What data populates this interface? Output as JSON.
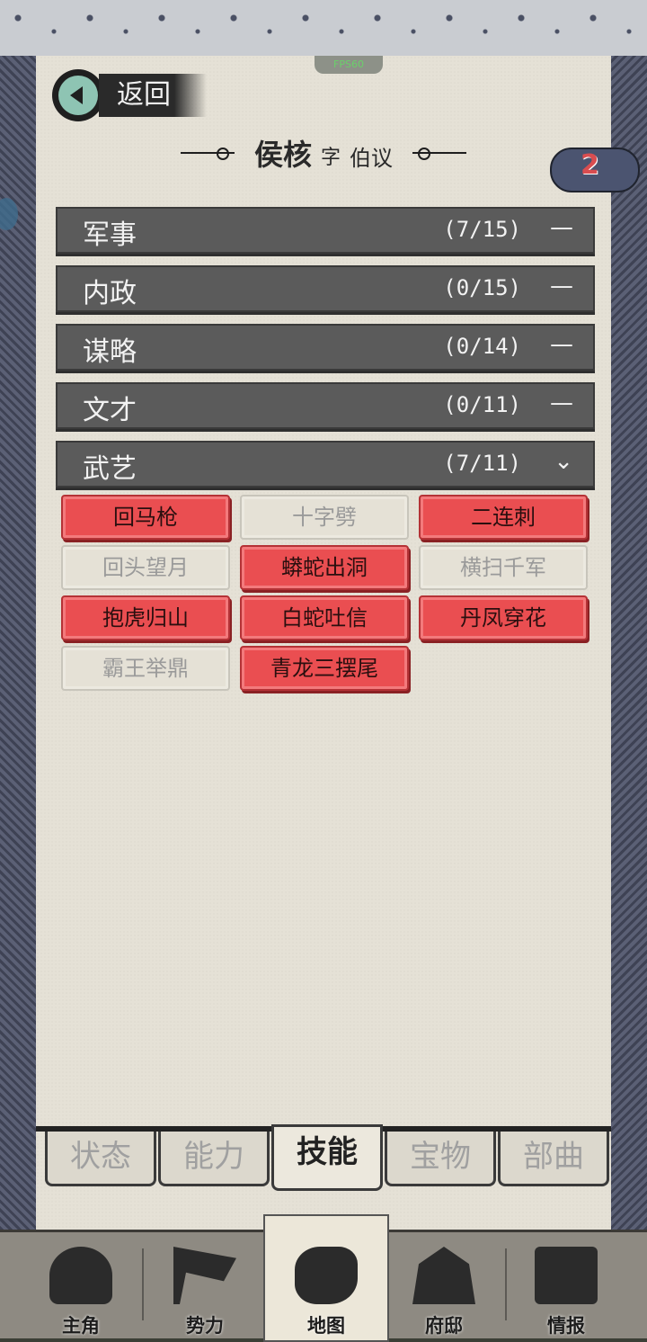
{
  "fps": "FPS60",
  "header": {
    "back_label": "返回"
  },
  "title": {
    "name": "侯核",
    "zi_label": "字",
    "courtesy": "伯议"
  },
  "badge": {
    "count": "2"
  },
  "categories": [
    {
      "name": "军事",
      "count": "(7/15)",
      "icon": "—",
      "state": "collapsed"
    },
    {
      "name": "内政",
      "count": "(0/15)",
      "icon": "—",
      "state": "collapsed"
    },
    {
      "name": "谋略",
      "count": "(0/14)",
      "icon": "—",
      "state": "collapsed"
    },
    {
      "name": "文才",
      "count": "(0/11)",
      "icon": "—",
      "state": "collapsed"
    },
    {
      "name": "武艺",
      "count": "(7/11)",
      "icon": "⌄",
      "state": "expanded"
    }
  ],
  "skills": [
    {
      "label": "回马枪",
      "learned": true
    },
    {
      "label": "十字劈",
      "learned": false
    },
    {
      "label": "二连刺",
      "learned": true
    },
    {
      "label": "回头望月",
      "learned": false
    },
    {
      "label": "蟒蛇出洞",
      "learned": true
    },
    {
      "label": "横扫千军",
      "learned": false
    },
    {
      "label": "抱虎归山",
      "learned": true
    },
    {
      "label": "白蛇吐信",
      "learned": true
    },
    {
      "label": "丹凤穿花",
      "learned": true
    },
    {
      "label": "霸王举鼎",
      "learned": false
    },
    {
      "label": "青龙三摆尾",
      "learned": true
    }
  ],
  "tabs": [
    {
      "label": "状态",
      "active": false
    },
    {
      "label": "能力",
      "active": false
    },
    {
      "label": "技能",
      "active": true
    },
    {
      "label": "宝物",
      "active": false
    },
    {
      "label": "部曲",
      "active": false
    }
  ],
  "bottom_nav": [
    {
      "label": "主角",
      "icon": "warrior-icon",
      "active": false
    },
    {
      "label": "势力",
      "icon": "flag-icon",
      "active": false
    },
    {
      "label": "地图",
      "icon": "map-icon",
      "active": true
    },
    {
      "label": "府邸",
      "icon": "mansion-icon",
      "active": false
    },
    {
      "label": "情报",
      "icon": "scroll-icon",
      "active": false
    }
  ],
  "colors": {
    "skill_on": "#ea4e51",
    "category_bar": "#5b5b5b",
    "paper": "#e5e1d6"
  }
}
